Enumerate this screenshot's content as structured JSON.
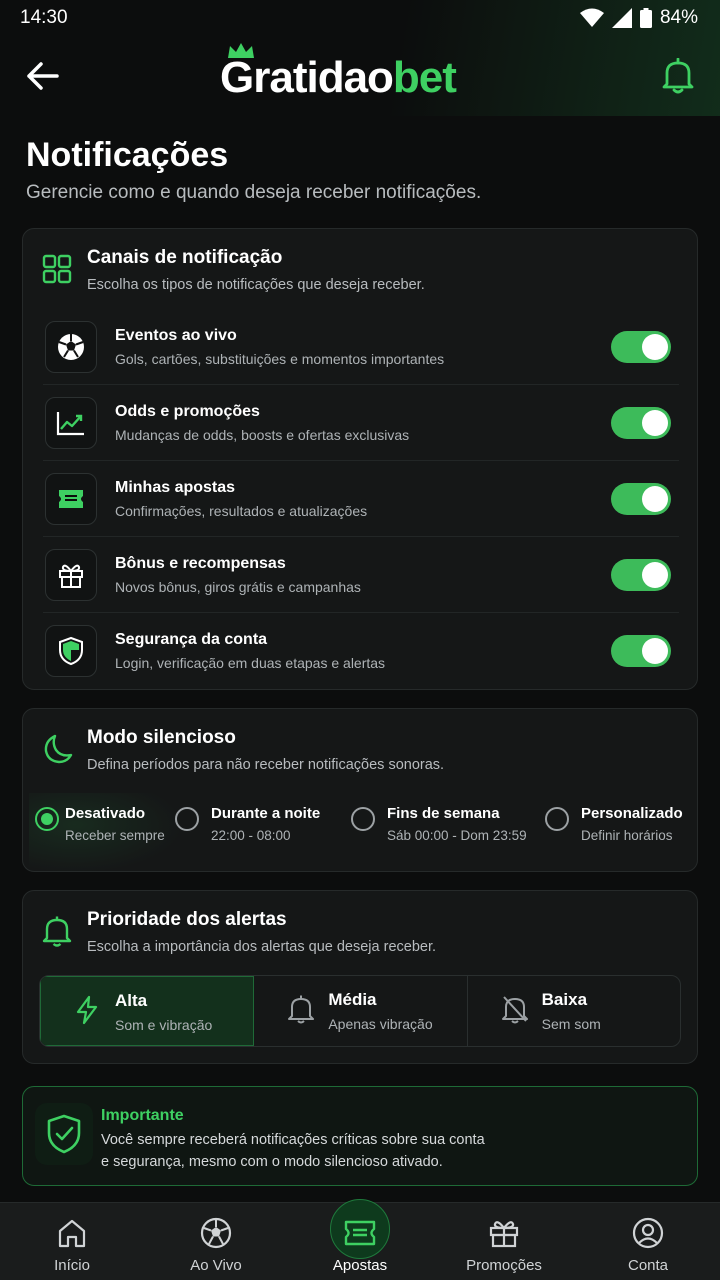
{
  "status_bar": {
    "time": "14:30",
    "battery": "84%"
  },
  "header": {
    "logo_part1": "Gratidao",
    "logo_part2": "bet"
  },
  "page": {
    "title": "Notificações",
    "subtitle": "Gerencie como e quando deseja receber notificações."
  },
  "channels": {
    "title": "Canais de notificação",
    "description": "Escolha os tipos de notificações que deseja receber.",
    "items": [
      {
        "title": "Eventos ao vivo",
        "description": "Gols, cartões, substituições e momentos importantes",
        "enabled": true,
        "icon": "soccer-ball-icon"
      },
      {
        "title": "Odds e promoções",
        "description": "Mudanças de odds, boosts e ofertas exclusivas",
        "enabled": true,
        "icon": "trend-chart-icon"
      },
      {
        "title": "Minhas apostas",
        "description": "Confirmações, resultados e atualizações",
        "enabled": true,
        "icon": "ticket-icon"
      },
      {
        "title": "Bônus e recompensas",
        "description": "Novos bônus, giros grátis e campanhas",
        "enabled": true,
        "icon": "gift-icon"
      },
      {
        "title": "Segurança da conta",
        "description": "Login, verificação em duas etapas e alertas",
        "enabled": true,
        "icon": "shield-icon"
      }
    ]
  },
  "silent_mode": {
    "title": "Modo silencioso",
    "description": "Defina períodos para não receber notificações sonoras.",
    "options": [
      {
        "title": "Desativado",
        "sub": "Receber sempre",
        "selected": true
      },
      {
        "title": "Durante a noite",
        "sub": "22:00 - 08:00",
        "selected": false
      },
      {
        "title": "Fins de semana",
        "sub": "Sáb 00:00 - Dom 23:59",
        "selected": false
      },
      {
        "title": "Personalizado",
        "sub": "Definir horários",
        "selected": false
      }
    ]
  },
  "priority": {
    "title": "Prioridade dos alertas",
    "description": "Escolha a importância dos alertas que deseja receber.",
    "options": [
      {
        "title": "Alta",
        "sub": "Som e vibração",
        "selected": true,
        "icon": "lightning-icon"
      },
      {
        "title": "Média",
        "sub": "Apenas vibração",
        "selected": false,
        "icon": "bell-icon"
      },
      {
        "title": "Baixa",
        "sub": "Sem som",
        "selected": false,
        "icon": "bell-off-icon"
      }
    ]
  },
  "important": {
    "title": "Importante",
    "line1": "Você sempre receberá notificações críticas sobre sua conta",
    "line2": "e segurança, mesmo com o modo silencioso ativado."
  },
  "bottom_nav": {
    "items": [
      {
        "label": "Início",
        "icon": "home-icon"
      },
      {
        "label": "Ao Vivo",
        "icon": "soccer-ball-icon"
      },
      {
        "label": "Apostas",
        "icon": "ticket-icon",
        "active": true
      },
      {
        "label": "Promoções",
        "icon": "gift-icon"
      },
      {
        "label": "Conta",
        "icon": "user-icon"
      }
    ]
  },
  "colors": {
    "accent": "#3ed062",
    "background": "#0c0d0d",
    "card": "#151717",
    "toggle_on": "#3dbb5a"
  }
}
